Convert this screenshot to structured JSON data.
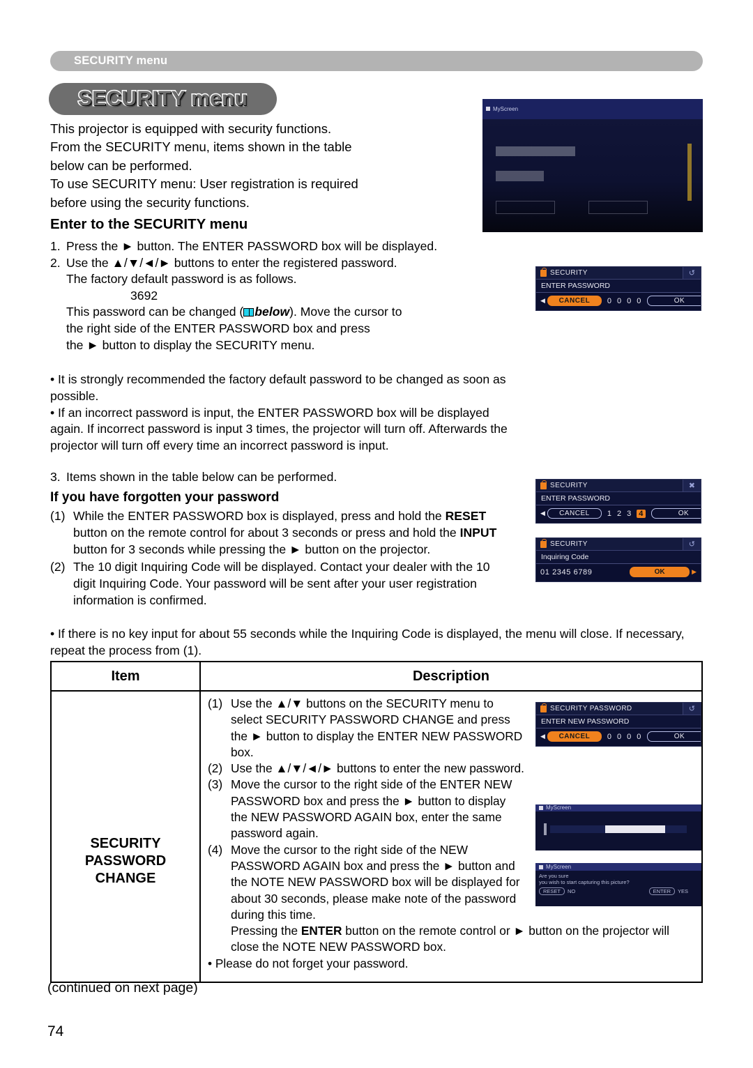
{
  "running_header": "SECURITY menu",
  "chapter_title": "SECURITY menu",
  "intro": {
    "l1": "This projector is equipped with security functions.",
    "l2": "From the SECURITY menu, items shown in the table",
    "l3": "below can be performed.",
    "l4": "To use SECURITY menu: User registration is required",
    "l5": "before using the security functions."
  },
  "section_enter": {
    "heading": "Enter to the SECURITY menu",
    "item1_num": "1.",
    "item1": "Press the ► button. The ENTER PASSWORD box will be displayed.",
    "item2_num": "2.",
    "item2": "Use the ▲/▼/◄/► buttons to enter the registered password.",
    "item2_l2": "The factory default password is as follows.",
    "password": "3692",
    "item2_l3a": "This password can be changed (",
    "item2_l3b": "below",
    "item2_l3c": "). Move the cursor to",
    "item2_l4": "the right side of the ENTER PASSWORD box and press",
    "item2_l5": "the ► button to display the SECURITY menu.",
    "bullet1": "• It is strongly recommended the factory default password to be changed as soon as possible.",
    "bullet2": "• If an incorrect password is input, the ENTER PASSWORD box will be displayed again. If incorrect password is input 3 times, the projector will turn off. Afterwards the projector will turn off every time an incorrect password is input.",
    "item3_num": "3.",
    "item3": "Items shown in the table below can be performed."
  },
  "section_forgot": {
    "heading": "If you have forgotten your password",
    "i1_num": "(1)",
    "i1_a": "While the ENTER PASSWORD box is displayed, press and hold the ",
    "i1_b": "RESET",
    "i1_c": " button on the remote control for about 3 seconds or press and hold the ",
    "i1_d": "INPUT",
    "i1_e": " button for 3 seconds while pressing the ► button on the projector.",
    "i2_num": "(2)",
    "i2": "The 10 digit Inquiring Code will be displayed. Contact your dealer with the 10 digit Inquiring Code. Your password will be sent after your user registration information is confirmed.",
    "note": "• If there is no key input for about 55 seconds while the Inquiring Code is displayed, the menu will close. If necessary, repeat the process from (1)."
  },
  "table": {
    "header_item": "Item",
    "header_description": "Description",
    "row_item_l1": "SECURITY",
    "row_item_l2": "PASSWORD",
    "row_item_l3": "CHANGE",
    "d1_num": "(1)",
    "d1": "Use the ▲/▼ buttons on the SECURITY menu to select SECURITY PASSWORD CHANGE and press the ► button to display the ENTER NEW PASSWORD box.",
    "d2_num": "(2)",
    "d2": "Use the ▲/▼/◄/► buttons to enter the new password.",
    "d3_num": "(3)",
    "d3": "Move the cursor to the right side of the ENTER NEW PASSWORD box and press the ► button to display the NEW PASSWORD AGAIN box, enter the same password again.",
    "d4_num": "(4)",
    "d4": "Move the cursor to the right side of the NEW PASSWORD AGAIN box and press the ► button and the NOTE NEW PASSWORD box will be displayed for about 30 seconds, please make note of the password during this time.",
    "d4_l2_a": "Pressing the ",
    "d4_l2_b": "ENTER",
    "d4_l2_c": " button on the remote control or ► button on the projector will close the NOTE NEW PASSWORD box.",
    "d5": "• Please do not forget your password."
  },
  "footer": {
    "continued": "(continued on next page)",
    "page_number": "74"
  },
  "osd": {
    "photo_top": {
      "title": "MyScreen"
    },
    "enter_password": {
      "title": "SECURITY",
      "subtitle": "ENTER PASSWORD",
      "cancel": "CANCEL",
      "digits": [
        "0",
        "0",
        "0",
        "0"
      ],
      "ok": "OK",
      "corner_icon": "return-icon"
    },
    "enter_password_reset": {
      "title": "SECURITY",
      "subtitle": "ENTER PASSWORD",
      "cancel": "CANCEL",
      "digits": [
        "1",
        "2",
        "3",
        "4"
      ],
      "selected_index": 3,
      "ok": "OK",
      "corner_icon": "close-icon"
    },
    "inquiring_code": {
      "title": "SECURITY",
      "subtitle": "Inquiring Code",
      "code": "01 2345 6789",
      "ok": "OK",
      "corner_icon": "return-icon"
    },
    "security_password": {
      "title": "SECURITY PASSWORD",
      "subtitle": "ENTER NEW PASSWORD",
      "cancel": "CANCEL",
      "digits": [
        "0",
        "0",
        "0",
        "0"
      ],
      "ok": "OK",
      "corner_icon": "return-icon"
    },
    "myscreen_progress": {
      "title": "MyScreen"
    },
    "myscreen_confirm": {
      "title": "MyScreen",
      "line1": "Are you sure",
      "line2": "you wish to start capturing this picture?",
      "btn_no_key": "RESET",
      "btn_no": "NO",
      "btn_yes_key": "ENTER",
      "btn_yes": "YES"
    }
  },
  "colors": {
    "accent_orange": "#f0821e",
    "osd_navy": "#0b0f30",
    "header_gray": "#b3b3b3",
    "title_gray": "#6e6e6e",
    "book_icon": "#22d3ee"
  }
}
